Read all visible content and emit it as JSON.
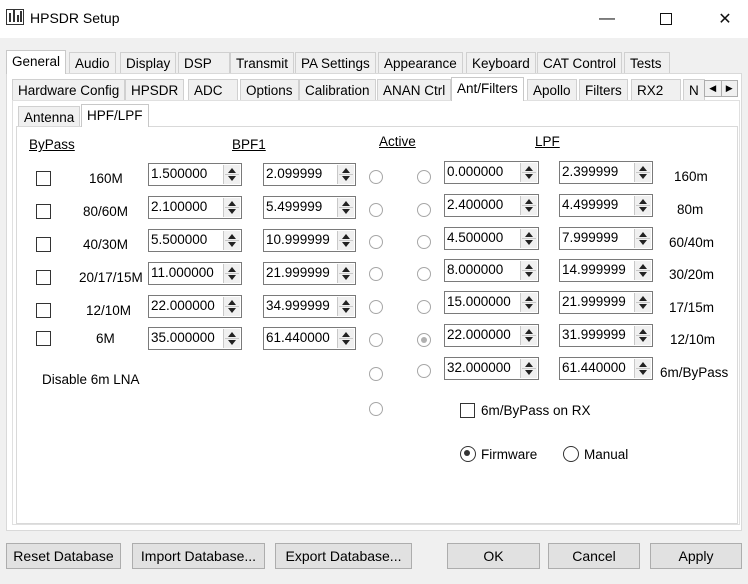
{
  "window": {
    "title": "HPSDR Setup"
  },
  "main_tabs": [
    "General",
    "Audio",
    "Display",
    "DSP",
    "Transmit",
    "PA Settings",
    "Appearance",
    "Keyboard",
    "CAT Control",
    "Tests"
  ],
  "general_tabs": [
    "Hardware Config",
    "HPSDR",
    "ADC",
    "Options",
    "Calibration",
    "ANAN Ctrl",
    "Ant/Filters",
    "Apollo",
    "Filters",
    "RX2",
    "N"
  ],
  "ant_tabs": [
    "Antenna",
    "HPF/LPF"
  ],
  "headers": {
    "bypass": "ByPass",
    "bpf1": "BPF1",
    "active": "Active",
    "lpf": "LPF"
  },
  "bpf_rows": [
    {
      "band": "160M",
      "low": "1.500000",
      "high": "2.099999"
    },
    {
      "band": "80/60M",
      "low": "2.100000",
      "high": "5.499999"
    },
    {
      "band": "40/30M",
      "low": "5.500000",
      "high": "10.999999"
    },
    {
      "band": "20/17/15M",
      "low": "11.000000",
      "high": "21.999999"
    },
    {
      "band": "12/10M",
      "low": "22.000000",
      "high": "34.999999"
    },
    {
      "band": "6M",
      "low": "35.000000",
      "high": "61.440000"
    }
  ],
  "lpf_rows": [
    {
      "band": "160m",
      "low": "0.000000",
      "high": "2.399999"
    },
    {
      "band": "80m",
      "low": "2.400000",
      "high": "4.499999"
    },
    {
      "band": "60/40m",
      "low": "4.500000",
      "high": "7.999999"
    },
    {
      "band": "30/20m",
      "low": "8.000000",
      "high": "14.999999"
    },
    {
      "band": "17/15m",
      "low": "15.000000",
      "high": "21.999999"
    },
    {
      "band": "12/10m",
      "low": "22.000000",
      "high": "31.999999"
    },
    {
      "band": "6m/ByPass",
      "low": "32.000000",
      "high": "61.440000"
    }
  ],
  "disable_lna_label": "Disable 6m LNA",
  "bypass_on_rx_label": "6m/ByPass on RX",
  "mode": {
    "firmware": "Firmware",
    "manual": "Manual",
    "selected": "Firmware"
  },
  "buttons": {
    "reset": "Reset Database",
    "import": "Import Database...",
    "export": "Export Database...",
    "ok": "OK",
    "cancel": "Cancel",
    "apply": "Apply"
  },
  "window_controls": {
    "minimize": "—",
    "close": "✕"
  }
}
